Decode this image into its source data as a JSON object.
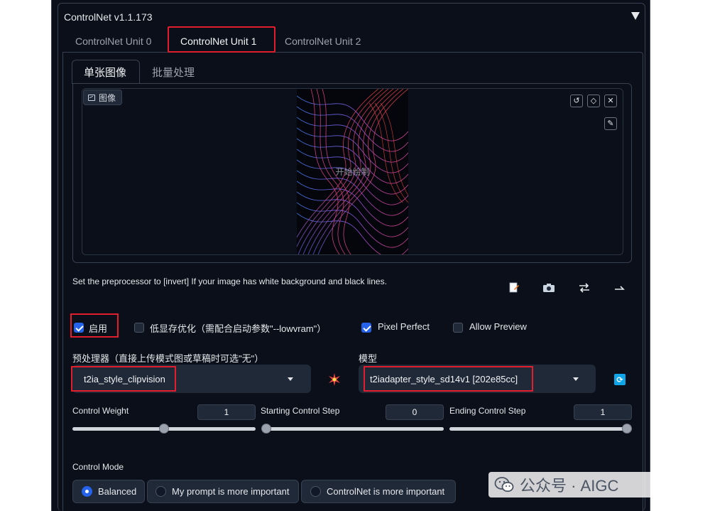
{
  "header": {
    "title": "ControlNet v1.1.173"
  },
  "unit_tabs": [
    "ControlNet Unit 0",
    "ControlNet Unit 1",
    "ControlNet Unit 2"
  ],
  "active_unit": "ControlNet Unit 1",
  "sub_tabs": [
    "单张图像",
    "批量处理"
  ],
  "image_panel": {
    "label": "图像",
    "canvas_caption": "开始绘制",
    "tools": {
      "reset": "↺",
      "erase": "◇",
      "close": "✕",
      "brush": "✎"
    }
  },
  "hint": "Set the preprocessor to [invert] If your image has white background and black lines.",
  "checkboxes": [
    {
      "label": "启用",
      "checked": true
    },
    {
      "label": "低显存优化（需配合启动参数\"--lowvram\"）",
      "checked": false
    },
    {
      "label": "Pixel Perfect",
      "checked": true
    },
    {
      "label": "Allow Preview",
      "checked": false
    }
  ],
  "preprocessor": {
    "label": "预处理器（直接上传模式图或草稿时可选\"无\"）",
    "value": "t2ia_style_clipvision"
  },
  "model": {
    "label": "模型",
    "value": "t2iadapter_style_sd14v1 [202e85cc]"
  },
  "sliders": [
    {
      "label": "Control Weight",
      "value": "1",
      "fraction": 0.5
    },
    {
      "label": "Starting Control Step",
      "value": "0",
      "fraction": 0.0
    },
    {
      "label": "Ending Control Step",
      "value": "1",
      "fraction": 1.0
    }
  ],
  "control_mode": {
    "label": "Control Mode",
    "options": [
      "Balanced",
      "My prompt is more important",
      "ControlNet is more important"
    ],
    "selected": "Balanced"
  },
  "watermark": {
    "text": "公众号 · AIGC"
  },
  "colors": {
    "accent": "#2563eb",
    "highlight": "#e11d2e",
    "panel": "#0b0f19",
    "refresh": "#0ea5e9"
  }
}
